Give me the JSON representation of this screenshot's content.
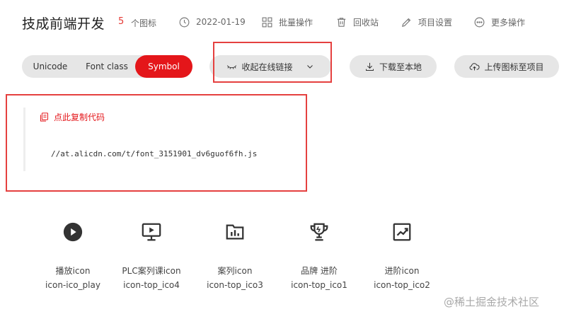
{
  "header": {
    "title": "技成前端开发",
    "icon_count": "5",
    "icon_count_label": "个图标",
    "date": "2022-01-19",
    "batch_label": "批量操作",
    "trash_label": "回收站",
    "settings_label": "项目设置",
    "more_label": "更多操作"
  },
  "toolbar": {
    "tabs": [
      {
        "label": "Unicode"
      },
      {
        "label": "Font class"
      },
      {
        "label": "Symbol",
        "active": true
      }
    ],
    "collapse_label": "收起在线链接",
    "download_label": "下载至本地",
    "upload_label": "上传图标至项目"
  },
  "code_panel": {
    "copy_label": "点此复制代码",
    "url": "//at.alicdn.com/t/font_3151901_dv6guof6fh.js"
  },
  "icons": [
    {
      "name": "播放icon",
      "code": "icon-ico_play",
      "glyph": "play-circle-icon"
    },
    {
      "name": "PLC案列课icon",
      "code": "icon-top_ico4",
      "glyph": "video-screen-icon"
    },
    {
      "name": "案列icon",
      "code": "icon-top_ico3",
      "glyph": "folder-chart-icon"
    },
    {
      "name": "品牌 进阶",
      "code": "icon-top_ico1",
      "glyph": "trophy-icon"
    },
    {
      "name": "进阶icon",
      "code": "icon-top_ico2",
      "glyph": "trend-chart-icon"
    }
  ],
  "watermark": "@稀土掘金技术社区",
  "colors": {
    "accent": "#e4161a",
    "pill_bg": "#e6e6e6",
    "highlight_box": "#e5403f"
  }
}
